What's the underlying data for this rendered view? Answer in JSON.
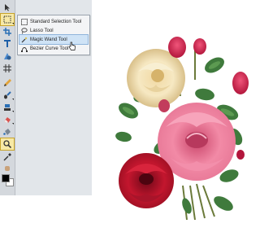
{
  "toolbar": {
    "tools": [
      {
        "name": "move-tool",
        "icon": "arrow-icon"
      },
      {
        "name": "selection-tool",
        "icon": "marquee-icon",
        "active": true
      },
      {
        "name": "crop-tool",
        "icon": "crop-icon"
      },
      {
        "name": "text-tool",
        "icon": "text-icon"
      },
      {
        "name": "shape-tool",
        "icon": "shape-icon"
      },
      {
        "name": "grid-tool",
        "icon": "grid-icon"
      },
      {
        "name": "pen-tool",
        "icon": "pen-icon"
      },
      {
        "name": "brush-tool",
        "icon": "brush-icon"
      },
      {
        "name": "clone-tool",
        "icon": "stamp-icon"
      },
      {
        "name": "eraser-tool",
        "icon": "eraser-icon"
      },
      {
        "name": "fill-tool",
        "icon": "bucket-icon"
      },
      {
        "name": "zoom-tool",
        "icon": "magnifier-icon"
      },
      {
        "name": "eyedropper-tool",
        "icon": "eyedropper-icon"
      }
    ],
    "foreground_color": "#000000",
    "background_color": "#ffffff"
  },
  "selection_menu": {
    "items": [
      {
        "label": "Standard Selection Tool",
        "icon": "rectangle-select-icon"
      },
      {
        "label": "Lasso Tool",
        "icon": "lasso-icon"
      },
      {
        "label": "Magic Wand Tool",
        "icon": "magic-wand-icon",
        "selected": true
      },
      {
        "label": "Bezier Curve Tool",
        "icon": "bezier-icon"
      }
    ]
  },
  "canvas": {
    "image": "vintage-rose-bouquet"
  }
}
